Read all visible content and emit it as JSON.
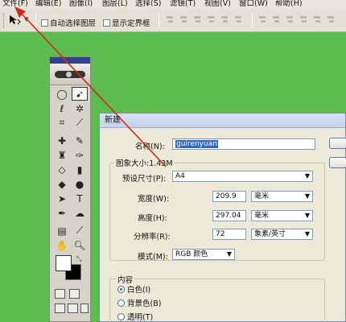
{
  "menubar": {
    "file": "文件(F)",
    "edit": "编辑(E)",
    "image": "图像(I)",
    "layer": "图层(L)",
    "select": "选择(S)",
    "filter": "滤镜(T)",
    "view": "视图(V)",
    "window": "窗口(W)",
    "help": "帮助(H)"
  },
  "options": {
    "auto_select": "自动选择图层",
    "show_bounds": "显示定界框"
  },
  "dialog": {
    "title": "新建",
    "name_label": "名称(N):",
    "name_value": "guirenyuan",
    "image_size": "图象大小:1.43M",
    "preset_label": "预设尺寸(P):",
    "preset_value": "A4",
    "width_label": "宽度(W):",
    "width_value": "209.9",
    "width_unit": "毫米",
    "height_label": "高度(H):",
    "height_value": "297.04",
    "height_unit": "毫米",
    "resolution_label": "分辨率(R):",
    "resolution_value": "72",
    "resolution_unit": "象素/英寸",
    "mode_label": "模式(M):",
    "mode_value": "RGB 颜色",
    "content_title": "内容",
    "content_options": [
      "白色(I)",
      "背景色(B)",
      "透明(T)"
    ]
  },
  "colors": {
    "background": "#5cbd4e",
    "arrow": "#d12a1c",
    "highlight": "#316ac5"
  }
}
